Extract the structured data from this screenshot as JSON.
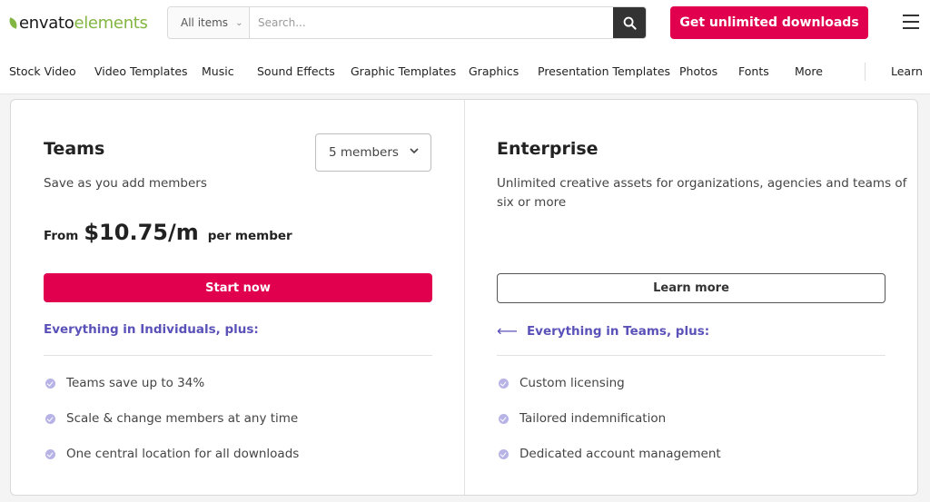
{
  "header": {
    "logo_part1": "envato",
    "logo_part2": "elements",
    "search": {
      "category": "All items",
      "placeholder": "Search..."
    },
    "cta_label": "Get unlimited downloads"
  },
  "nav": {
    "items": [
      "Stock Video",
      "Video Templates",
      "Music",
      "Sound Effects",
      "Graphic Templates",
      "Graphics",
      "Presentation Templates",
      "Photos",
      "Fonts",
      "More",
      "Learn"
    ]
  },
  "teams": {
    "title": "Teams",
    "subtitle": "Save as you add members",
    "members_select": "5 members",
    "price_from": "From",
    "price_amount": "$10.75/m",
    "price_unit": "per member",
    "button": "Start now",
    "plus_heading": "Everything in Individuals, plus:",
    "features": [
      "Teams save up to 34%",
      "Scale & change members at any time",
      "One central location for all downloads"
    ]
  },
  "enterprise": {
    "title": "Enterprise",
    "subtitle_line1": "Unlimited creative assets for organizations, agencies and teams of",
    "subtitle_line2": "six or more",
    "button": "Learn more",
    "plus_heading": "Everything in Teams, plus:",
    "features": [
      "Custom licensing",
      "Tailored indemnification",
      "Dedicated account management"
    ]
  },
  "colors": {
    "brand_green": "#82b541",
    "accent_pink": "#e0004d",
    "link_purple": "#5a52b8",
    "check_dot": "#b7b3e6"
  }
}
